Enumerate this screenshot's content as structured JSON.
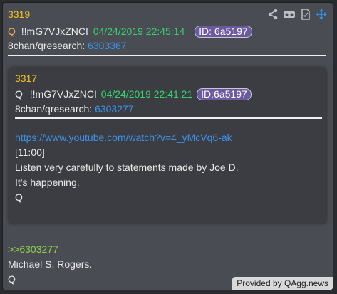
{
  "post": {
    "number": "3319",
    "name": "Q",
    "tripcode": "!!mG7VJxZNCI",
    "timestamp": "04/24/2019 22:45:14",
    "id": "ID: 6a5197",
    "board": "8chan/qresearch:",
    "post_link": "6303367"
  },
  "quoted": {
    "number": "3317",
    "name": "Q",
    "tripcode": "!!mG7VJxZNCI",
    "timestamp": "04/24/2019 22:41:21",
    "id": "ID:6a5197",
    "board": "8chan/qresearch:",
    "post_link": "6303277",
    "url": "https://www.youtube.com/watch?v=4_yMcVq6-ak",
    "lines": [
      "[11:00]",
      "Listen very carefully to statements made by Joe D.",
      "It's happening.",
      "Q"
    ]
  },
  "reply": {
    "quote_link": ">>6303277",
    "lines": [
      "Michael S. Rogers.",
      "Q"
    ]
  },
  "footer": "Provided by QAgg.news",
  "colors": {
    "accent_yellow": "#f2c21b",
    "date_green": "#36d36e",
    "link_blue": "#3a93e8",
    "greentext": "#8fd14a"
  },
  "toolbar_icons": [
    "share-icon",
    "vr-glasses-icon",
    "document-icon",
    "move-icon"
  ]
}
